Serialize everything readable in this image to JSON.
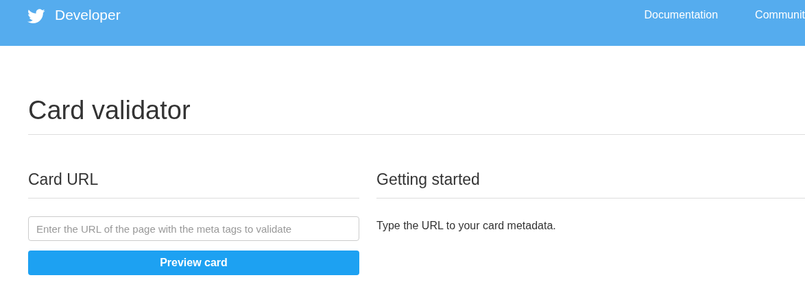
{
  "header": {
    "brand": "Developer",
    "nav": [
      "Documentation",
      "Communit"
    ]
  },
  "page": {
    "title": "Card validator"
  },
  "card_url": {
    "heading": "Card URL",
    "field": {
      "placeholder": "Enter the URL of the page with the meta tags to validate"
    },
    "button": "Preview card"
  },
  "getting_started": {
    "heading": "Getting started",
    "text": "Type the URL to your card metadata."
  }
}
